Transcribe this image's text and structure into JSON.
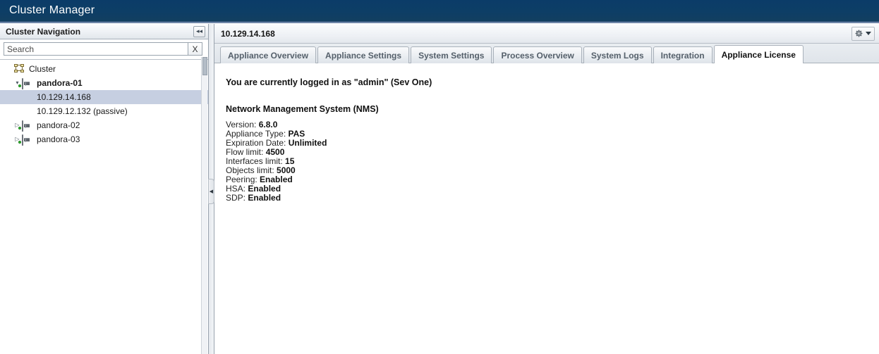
{
  "app": {
    "title": "Cluster Manager"
  },
  "sidebar": {
    "header_title": "Cluster Navigation",
    "collapse_icon": "chevron-double-left-icon",
    "search": {
      "placeholder": "Search",
      "value": "",
      "clear_label": "X"
    },
    "tree": [
      {
        "label": "Cluster",
        "type": "cluster",
        "level": 0,
        "twisty": "",
        "bold": false,
        "selected": false
      },
      {
        "label": "pandora-01",
        "type": "server",
        "level": 1,
        "twisty": "expanded",
        "bold": true,
        "selected": false
      },
      {
        "label": "10.129.14.168",
        "type": "leaf",
        "level": 2,
        "twisty": "",
        "bold": false,
        "selected": true
      },
      {
        "label": "10.129.12.132 (passive)",
        "type": "leaf",
        "level": 2,
        "twisty": "",
        "bold": false,
        "selected": false
      },
      {
        "label": "pandora-02",
        "type": "server",
        "level": 1,
        "twisty": "collapsed",
        "bold": false,
        "selected": false
      },
      {
        "label": "pandora-03",
        "type": "server",
        "level": 1,
        "twisty": "collapsed",
        "bold": false,
        "selected": false
      }
    ]
  },
  "splitter": {
    "handle_icon": "collapse-left-arrow-icon"
  },
  "content": {
    "title": "10.129.14.168",
    "gear": {
      "icon": "gear-icon",
      "caret": "chevron-down-icon"
    },
    "tabs": [
      {
        "label": "Appliance Overview",
        "active": false
      },
      {
        "label": "Appliance Settings",
        "active": false
      },
      {
        "label": "System Settings",
        "active": false
      },
      {
        "label": "Process Overview",
        "active": false
      },
      {
        "label": "System Logs",
        "active": false
      },
      {
        "label": "Integration",
        "active": false
      },
      {
        "label": "Appliance License",
        "active": true
      }
    ],
    "license": {
      "logged_in_line": "You are currently logged in as \"admin\" (Sev One)",
      "product_heading": "Network Management System (NMS)",
      "rows": [
        {
          "label": "Version:",
          "value": "6.8.0"
        },
        {
          "label": "Appliance Type:",
          "value": "PAS"
        },
        {
          "label": "Expiration Date:",
          "value": "Unlimited"
        },
        {
          "label": "Flow limit:",
          "value": "4500"
        },
        {
          "label": "Interfaces limit:",
          "value": "15"
        },
        {
          "label": "Objects limit:",
          "value": "5000"
        },
        {
          "label": "Peering:",
          "value": "Enabled"
        },
        {
          "label": "HSA:",
          "value": "Enabled"
        },
        {
          "label": "SDP:",
          "value": "Enabled"
        }
      ]
    }
  },
  "colors": {
    "titlebar_navy": "#0c3c66",
    "selection_blue": "#c6cfe1",
    "tab_text": "#55606b",
    "led_green": "#31c031"
  }
}
